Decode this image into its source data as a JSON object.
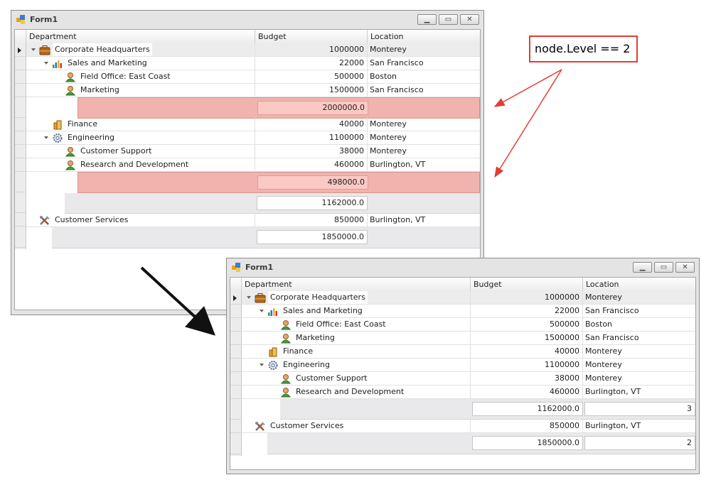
{
  "callout": {
    "text": "node.Level == 2"
  },
  "window1": {
    "title": "Form1",
    "columns": {
      "department": "Department",
      "budget": "Budget",
      "location": "Location"
    },
    "rows": [
      {
        "dept": "Corporate Headquarters",
        "budget": "1000000",
        "location": "Monterey",
        "icon": "briefcase-icon"
      },
      {
        "dept": "Sales and Marketing",
        "budget": "22000",
        "location": "San Francisco",
        "icon": "bar-chart-icon"
      },
      {
        "dept": "Field Office: East Coast",
        "budget": "500000",
        "location": "Boston",
        "icon": "person-icon"
      },
      {
        "dept": "Marketing",
        "budget": "1500000",
        "location": "San Francisco",
        "icon": "person-icon"
      },
      {
        "dept": "Finance",
        "budget": "40000",
        "location": "Monterey",
        "icon": "coins-icon"
      },
      {
        "dept": "Engineering",
        "budget": "1100000",
        "location": "Monterey",
        "icon": "gear-icon"
      },
      {
        "dept": "Customer Support",
        "budget": "38000",
        "location": "Monterey",
        "icon": "person-icon"
      },
      {
        "dept": "Research and Development",
        "budget": "460000",
        "location": "Burlington, VT",
        "icon": "person-icon"
      },
      {
        "dept": "Customer Services",
        "budget": "850000",
        "location": "Burlington, VT",
        "icon": "tools-icon"
      }
    ],
    "footers": {
      "sales_sum": "2000000.0",
      "engineering_sum": "498000.0",
      "corporate_sum": "1162000.0",
      "root_sum": "1850000.0"
    }
  },
  "window2": {
    "title": "Form1",
    "columns": {
      "department": "Department",
      "budget": "Budget",
      "location": "Location"
    },
    "rows": [
      {
        "dept": "Corporate Headquarters",
        "budget": "1000000",
        "location": "Monterey",
        "icon": "briefcase-icon"
      },
      {
        "dept": "Sales and Marketing",
        "budget": "22000",
        "location": "San Francisco",
        "icon": "bar-chart-icon"
      },
      {
        "dept": "Field Office: East Coast",
        "budget": "500000",
        "location": "Boston",
        "icon": "person-icon"
      },
      {
        "dept": "Marketing",
        "budget": "1500000",
        "location": "San Francisco",
        "icon": "person-icon"
      },
      {
        "dept": "Finance",
        "budget": "40000",
        "location": "Monterey",
        "icon": "coins-icon"
      },
      {
        "dept": "Engineering",
        "budget": "1100000",
        "location": "Monterey",
        "icon": "gear-icon"
      },
      {
        "dept": "Customer Support",
        "budget": "38000",
        "location": "Monterey",
        "icon": "person-icon"
      },
      {
        "dept": "Research and Development",
        "budget": "460000",
        "location": "Burlington, VT",
        "icon": "person-icon"
      },
      {
        "dept": "Customer Services",
        "budget": "850000",
        "location": "Burlington, VT",
        "icon": "tools-icon"
      }
    ],
    "footers": {
      "corporate_sum": "1162000.0",
      "corporate_count": "3",
      "root_sum": "1850000.0",
      "root_count": "2"
    }
  },
  "colors": {
    "highlight_footer": "#f0b3ae",
    "callout_border": "#e43c35",
    "arrow": "#e43c35"
  }
}
